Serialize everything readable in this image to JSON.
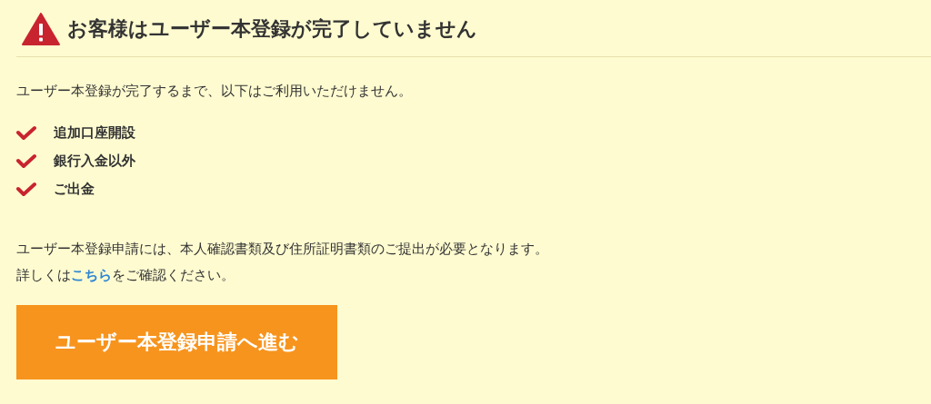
{
  "heading": {
    "title": "お客様はユーザー本登録が完了していません"
  },
  "intro": "ユーザー本登録が完了するまで、以下はご利用いただけません。",
  "restrictions": [
    {
      "label": "追加口座開設"
    },
    {
      "label": "銀行入金以外"
    },
    {
      "label": "ご出金"
    }
  ],
  "notice": "ユーザー本登録申請には、本人確認書類及び住所証明書類のご提出が必要となります。",
  "details": {
    "before": "詳しくは",
    "link": "こちら",
    "after": "をご確認ください。"
  },
  "button": "ユーザー本登録申請へ進む"
}
